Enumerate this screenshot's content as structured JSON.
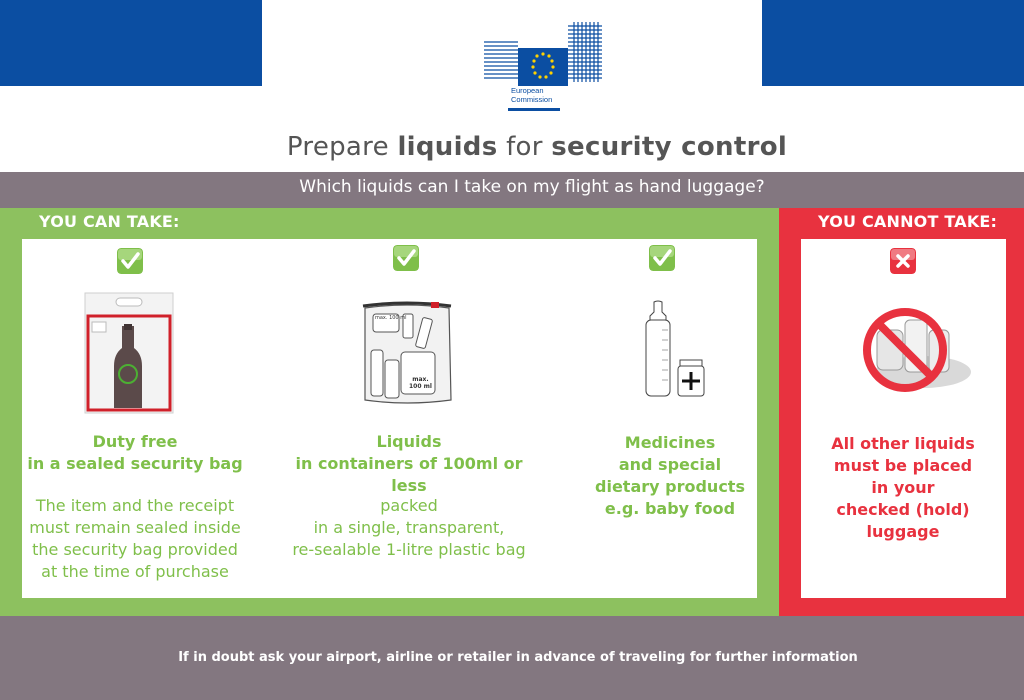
{
  "header": {
    "logo_text": "European\nCommission",
    "title_parts": [
      "Prepare ",
      "liquids",
      " for ",
      "security control"
    ],
    "subtitle": "Which liquids can I take on my flight as hand luggage?"
  },
  "can_take": {
    "label": "YOU CAN TAKE:",
    "items": [
      {
        "icon": "duty-free-bag-icon",
        "heading": "Duty free\nin a sealed security bag",
        "body": "The item and the receipt\nmust remain sealed inside\nthe security bag provided\nat the time of purchase"
      },
      {
        "icon": "liquids-bag-icon",
        "heading": "Liquids\nin containers of 100ml or less",
        "body": "packed\nin a single, transparent,\nre-sealable 1-litre plastic bag",
        "container_labels": [
          "max. 100 ml",
          "max. 100 ml",
          "max.\n100 ml"
        ]
      },
      {
        "icon": "baby-bottle-medicine-icon",
        "heading": "Medicines\nand special\ndietary products\ne.g. baby food"
      }
    ]
  },
  "cannot_take": {
    "label": "YOU CANNOT TAKE:",
    "heading": "All other liquids\nmust be placed\nin your\nchecked (hold)\nluggage"
  },
  "footer": {
    "text": "If in doubt ask your airport, airline or retailer in advance of traveling for further information"
  },
  "colors": {
    "eu_blue": "#0b4ea2",
    "can_green": "#8dc15f",
    "cannot_red": "#e8323f",
    "bar_grey": "#837780"
  }
}
